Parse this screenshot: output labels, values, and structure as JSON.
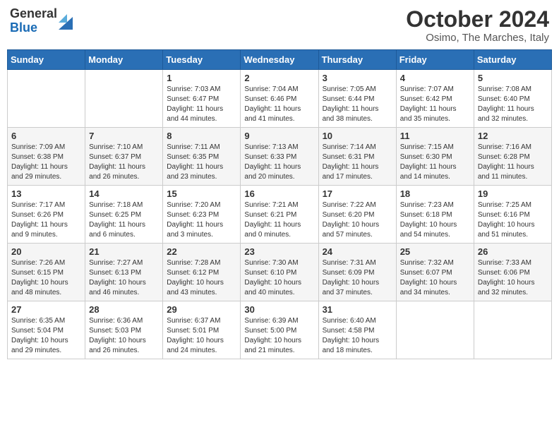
{
  "logo": {
    "line1": "General",
    "line2": "Blue"
  },
  "title": "October 2024",
  "location": "Osimo, The Marches, Italy",
  "days_header": [
    "Sunday",
    "Monday",
    "Tuesday",
    "Wednesday",
    "Thursday",
    "Friday",
    "Saturday"
  ],
  "weeks": [
    [
      {
        "day": "",
        "content": ""
      },
      {
        "day": "",
        "content": ""
      },
      {
        "day": "1",
        "content": "Sunrise: 7:03 AM\nSunset: 6:47 PM\nDaylight: 11 hours and 44 minutes."
      },
      {
        "day": "2",
        "content": "Sunrise: 7:04 AM\nSunset: 6:46 PM\nDaylight: 11 hours and 41 minutes."
      },
      {
        "day": "3",
        "content": "Sunrise: 7:05 AM\nSunset: 6:44 PM\nDaylight: 11 hours and 38 minutes."
      },
      {
        "day": "4",
        "content": "Sunrise: 7:07 AM\nSunset: 6:42 PM\nDaylight: 11 hours and 35 minutes."
      },
      {
        "day": "5",
        "content": "Sunrise: 7:08 AM\nSunset: 6:40 PM\nDaylight: 11 hours and 32 minutes."
      }
    ],
    [
      {
        "day": "6",
        "content": "Sunrise: 7:09 AM\nSunset: 6:38 PM\nDaylight: 11 hours and 29 minutes."
      },
      {
        "day": "7",
        "content": "Sunrise: 7:10 AM\nSunset: 6:37 PM\nDaylight: 11 hours and 26 minutes."
      },
      {
        "day": "8",
        "content": "Sunrise: 7:11 AM\nSunset: 6:35 PM\nDaylight: 11 hours and 23 minutes."
      },
      {
        "day": "9",
        "content": "Sunrise: 7:13 AM\nSunset: 6:33 PM\nDaylight: 11 hours and 20 minutes."
      },
      {
        "day": "10",
        "content": "Sunrise: 7:14 AM\nSunset: 6:31 PM\nDaylight: 11 hours and 17 minutes."
      },
      {
        "day": "11",
        "content": "Sunrise: 7:15 AM\nSunset: 6:30 PM\nDaylight: 11 hours and 14 minutes."
      },
      {
        "day": "12",
        "content": "Sunrise: 7:16 AM\nSunset: 6:28 PM\nDaylight: 11 hours and 11 minutes."
      }
    ],
    [
      {
        "day": "13",
        "content": "Sunrise: 7:17 AM\nSunset: 6:26 PM\nDaylight: 11 hours and 9 minutes."
      },
      {
        "day": "14",
        "content": "Sunrise: 7:18 AM\nSunset: 6:25 PM\nDaylight: 11 hours and 6 minutes."
      },
      {
        "day": "15",
        "content": "Sunrise: 7:20 AM\nSunset: 6:23 PM\nDaylight: 11 hours and 3 minutes."
      },
      {
        "day": "16",
        "content": "Sunrise: 7:21 AM\nSunset: 6:21 PM\nDaylight: 11 hours and 0 minutes."
      },
      {
        "day": "17",
        "content": "Sunrise: 7:22 AM\nSunset: 6:20 PM\nDaylight: 10 hours and 57 minutes."
      },
      {
        "day": "18",
        "content": "Sunrise: 7:23 AM\nSunset: 6:18 PM\nDaylight: 10 hours and 54 minutes."
      },
      {
        "day": "19",
        "content": "Sunrise: 7:25 AM\nSunset: 6:16 PM\nDaylight: 10 hours and 51 minutes."
      }
    ],
    [
      {
        "day": "20",
        "content": "Sunrise: 7:26 AM\nSunset: 6:15 PM\nDaylight: 10 hours and 48 minutes."
      },
      {
        "day": "21",
        "content": "Sunrise: 7:27 AM\nSunset: 6:13 PM\nDaylight: 10 hours and 46 minutes."
      },
      {
        "day": "22",
        "content": "Sunrise: 7:28 AM\nSunset: 6:12 PM\nDaylight: 10 hours and 43 minutes."
      },
      {
        "day": "23",
        "content": "Sunrise: 7:30 AM\nSunset: 6:10 PM\nDaylight: 10 hours and 40 minutes."
      },
      {
        "day": "24",
        "content": "Sunrise: 7:31 AM\nSunset: 6:09 PM\nDaylight: 10 hours and 37 minutes."
      },
      {
        "day": "25",
        "content": "Sunrise: 7:32 AM\nSunset: 6:07 PM\nDaylight: 10 hours and 34 minutes."
      },
      {
        "day": "26",
        "content": "Sunrise: 7:33 AM\nSunset: 6:06 PM\nDaylight: 10 hours and 32 minutes."
      }
    ],
    [
      {
        "day": "27",
        "content": "Sunrise: 6:35 AM\nSunset: 5:04 PM\nDaylight: 10 hours and 29 minutes."
      },
      {
        "day": "28",
        "content": "Sunrise: 6:36 AM\nSunset: 5:03 PM\nDaylight: 10 hours and 26 minutes."
      },
      {
        "day": "29",
        "content": "Sunrise: 6:37 AM\nSunset: 5:01 PM\nDaylight: 10 hours and 24 minutes."
      },
      {
        "day": "30",
        "content": "Sunrise: 6:39 AM\nSunset: 5:00 PM\nDaylight: 10 hours and 21 minutes."
      },
      {
        "day": "31",
        "content": "Sunrise: 6:40 AM\nSunset: 4:58 PM\nDaylight: 10 hours and 18 minutes."
      },
      {
        "day": "",
        "content": ""
      },
      {
        "day": "",
        "content": ""
      }
    ]
  ]
}
